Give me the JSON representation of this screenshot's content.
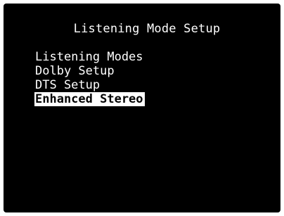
{
  "osd": {
    "title": "Listening Mode Setup",
    "menu_items": [
      {
        "label": "Listening Modes",
        "selected": false
      },
      {
        "label": "Dolby Setup",
        "selected": false
      },
      {
        "label": "DTS Setup",
        "selected": false
      },
      {
        "label": "Enhanced Stereo",
        "selected": true
      }
    ],
    "colors": {
      "background": "#000000",
      "text": "#ffffff",
      "highlight": "#ffffff",
      "highlight_text": "#000000"
    }
  }
}
